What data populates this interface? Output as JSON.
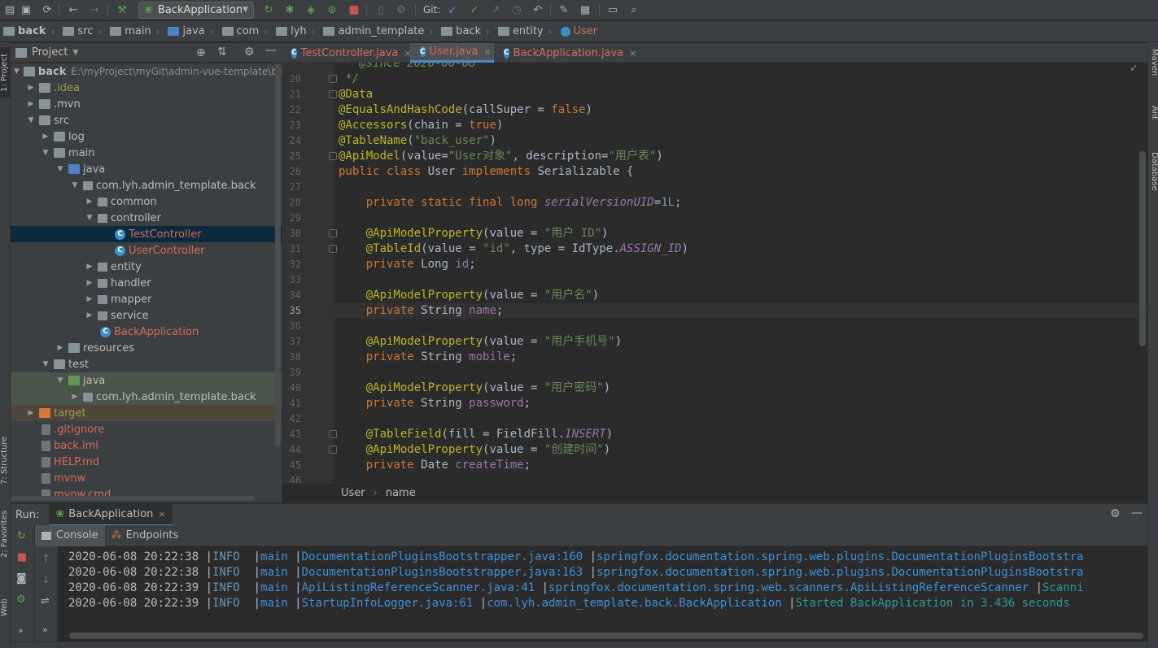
{
  "toolbar": {
    "run_config": "BackApplication",
    "git_label": "Git:"
  },
  "breadcrumb": [
    "back",
    "src",
    "main",
    "java",
    "com",
    "lyh",
    "admin_template",
    "back",
    "entity",
    "User"
  ],
  "project_panel": {
    "title": "Project",
    "root_name": "back",
    "root_path": "E:\\myProject\\myGit\\admin-vue-template\\back",
    "items": [
      {
        "label": ".idea"
      },
      {
        "label": ".mvn"
      },
      {
        "label": "src"
      },
      {
        "label": "log"
      },
      {
        "label": "main"
      },
      {
        "label": "java"
      },
      {
        "label": "com.lyh.admin_template.back"
      },
      {
        "label": "common"
      },
      {
        "label": "controller"
      },
      {
        "label": "TestController"
      },
      {
        "label": "UserController"
      },
      {
        "label": "entity"
      },
      {
        "label": "handler"
      },
      {
        "label": "mapper"
      },
      {
        "label": "service"
      },
      {
        "label": "BackApplication"
      },
      {
        "label": "resources"
      },
      {
        "label": "test"
      },
      {
        "label": "java"
      },
      {
        "label": "com.lyh.admin_template.back"
      },
      {
        "label": "target"
      },
      {
        "label": ".gitignore"
      },
      {
        "label": "back.iml"
      },
      {
        "label": "HELP.md"
      },
      {
        "label": "mvnw"
      },
      {
        "label": "mvnw.cmd"
      }
    ]
  },
  "editor_tabs": [
    "TestController.java",
    "User.java",
    "BackApplication.java"
  ],
  "editor": {
    "top_partial": " * @since 2020-06-08",
    "line_numbers": [
      "20",
      "21",
      "22",
      "23",
      "24",
      "25",
      "26",
      "27",
      "28",
      "29",
      "30",
      "31",
      "32",
      "33",
      "34",
      "35",
      "36",
      "37",
      "38",
      "39",
      "40",
      "41",
      "42",
      "43",
      "44",
      "45",
      "46"
    ],
    "current_line": "35"
  },
  "editor_crumb": [
    "User",
    "name"
  ],
  "run_panel": {
    "title": "Run:",
    "config": "BackApplication",
    "console_tab": "Console",
    "endpoints_tab": "Endpoints"
  },
  "console_lines": [
    {
      "ts": "2020-06-08 20:22:38",
      "level": "INFO",
      "thread": "main",
      "src": "DocumentationPluginsBootstrapper.java:160",
      "cls": "springfox.documentation.spring.web.plugins.DocumentationPluginsBootstra",
      "msg": ""
    },
    {
      "ts": "2020-06-08 20:22:38",
      "level": "INFO",
      "thread": "main",
      "src": "DocumentationPluginsBootstrapper.java:163",
      "cls": "springfox.documentation.spring.web.plugins.DocumentationPluginsBootstra",
      "msg": ""
    },
    {
      "ts": "2020-06-08 20:22:39",
      "level": "INFO",
      "thread": "main",
      "src": "ApiListingReferenceScanner.java:41",
      "cls": "springfox.documentation.spring.web.scanners.ApiListingReferenceScanner",
      "msg": "Scanni"
    },
    {
      "ts": "2020-06-08 20:22:39",
      "level": "INFO",
      "thread": "main",
      "src": "StartupInfoLogger.java:61",
      "cls": "com.lyh.admin_template.back.BackApplication",
      "msg": "Started BackApplication in 3.436 seconds"
    }
  ],
  "side_tabs": {
    "left": [
      "1: Project",
      "7: Structure",
      "2: Favorites",
      "Web"
    ],
    "right": [
      "Maven",
      "Ant",
      "Database"
    ]
  },
  "colors": {
    "accent": "#4a88c7",
    "selection": "#0d293e",
    "modified_red": "#d26b5c"
  }
}
